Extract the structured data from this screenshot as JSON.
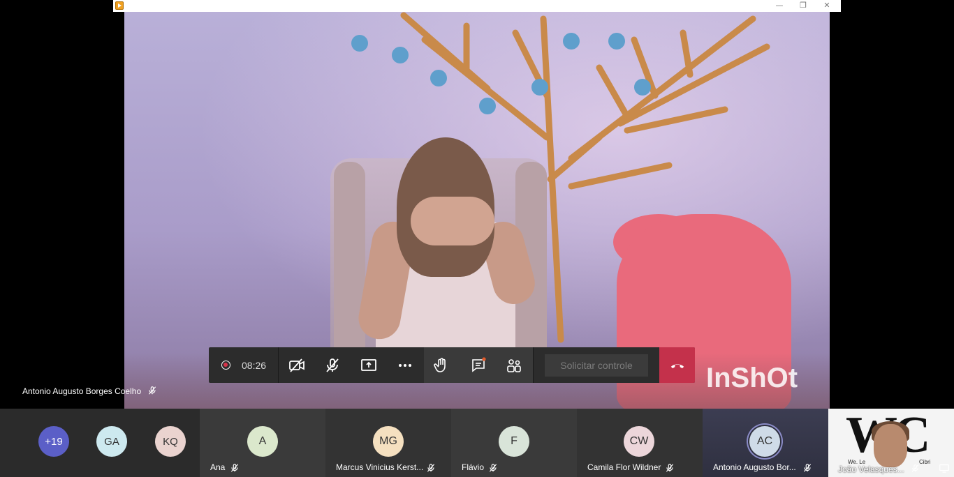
{
  "window": {
    "minimize_glyph": "—",
    "restore_glyph": "❐",
    "close_glyph": "✕"
  },
  "main_video": {
    "participant_name": "Antonio Augusto Borges Coelho",
    "watermark": "InShOt"
  },
  "controls": {
    "recording_time": "08:26",
    "request_control_label": "Solicitar controle",
    "buttons": [
      "camera-off",
      "mic-off",
      "share-screen",
      "more-options",
      "raise-hand",
      "chat",
      "participants",
      "hang-up"
    ]
  },
  "strip": {
    "overflow": {
      "count": "+19",
      "color": "#5b5fc7"
    },
    "mini": [
      {
        "initials": "GA",
        "color": "#cde9ef"
      },
      {
        "initials": "KQ",
        "color": "#ead3cf"
      }
    ],
    "tiles": [
      {
        "initials": "A",
        "name": "Ana",
        "color": "#dbe8cc"
      },
      {
        "initials": "MG",
        "name": "Marcus Vinicius Kerst...",
        "color": "#f5e0c0"
      },
      {
        "initials": "F",
        "name": "Flávio",
        "color": "#d9e4d9"
      },
      {
        "initials": "CW",
        "name": "Camila Flor Wildner",
        "color": "#ecd6da"
      },
      {
        "initials": "AC",
        "name": "Antonio Augusto Bor...",
        "color": "#cfdbe8",
        "active": true
      }
    ],
    "self": {
      "name": "João Velasques...",
      "logo": "WC",
      "sub_left": "We. Le",
      "sub_right": "Cibri"
    }
  }
}
